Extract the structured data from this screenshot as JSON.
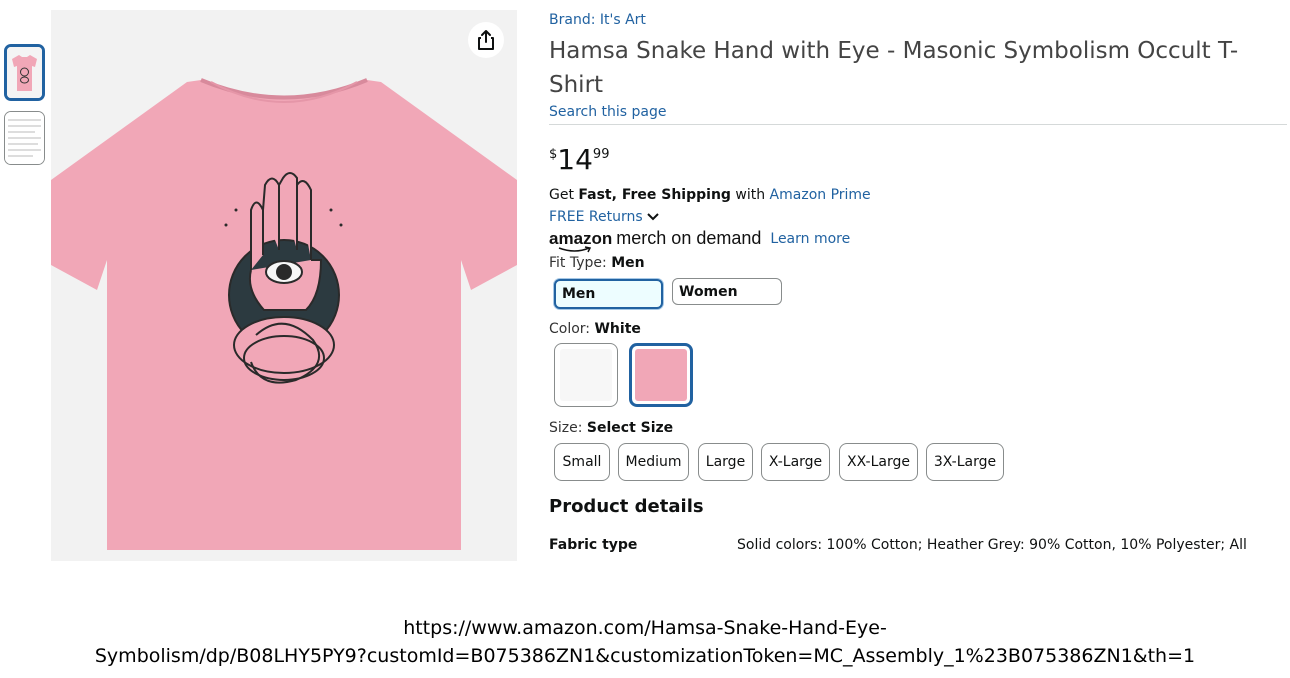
{
  "product": {
    "brand": "Brand: It's Art",
    "title": "Hamsa Snake Hand with Eye - Masonic Symbolism Occult T-Shirt",
    "search_link": "Search this page",
    "price": {
      "symbol": "$",
      "whole": "14",
      "fraction": "99"
    },
    "shipping": {
      "prefix": "Get ",
      "bold": "Fast, Free Shipping",
      "middle": " with ",
      "link": "Amazon Prime"
    },
    "returns": "FREE Returns",
    "merch": {
      "logo": "amazon",
      "text": "merch on demand",
      "learn_more": "Learn more"
    },
    "fit": {
      "label": "Fit Type: ",
      "value": "Men",
      "options": [
        "Men",
        "Women"
      ],
      "selected": "Men"
    },
    "color": {
      "label": "Color: ",
      "value": "White",
      "swatches": [
        {
          "name": "White",
          "hex": "#f7f7f7"
        },
        {
          "name": "Pink",
          "hex": "#f1a7b7"
        }
      ],
      "selected_index": 1
    },
    "size": {
      "label": "Size: ",
      "value": "Select Size",
      "options": [
        "Small",
        "Medium",
        "Large",
        "X-Large",
        "XX-Large",
        "3X-Large"
      ]
    },
    "details": {
      "heading": "Product details",
      "rows": [
        {
          "label": "Fabric type",
          "value": "Solid colors: 100% Cotton; Heather Grey: 90% Cotton, 10% Polyester; All"
        }
      ]
    }
  },
  "caption": {
    "line1": "https://www.amazon.com/Hamsa-Snake-Hand-Eye-",
    "line2": "Symbolism/dp/B08LHY5PY9?customId=B075386ZN1&customizationToken=MC_Assembly_1%23B075386ZN1&th=1"
  },
  "colors": {
    "link": "#2162a1",
    "shirt": "#f1a7b7",
    "selected_border": "#2162a1"
  },
  "icons": [
    "share-icon",
    "chevron-down-icon"
  ]
}
